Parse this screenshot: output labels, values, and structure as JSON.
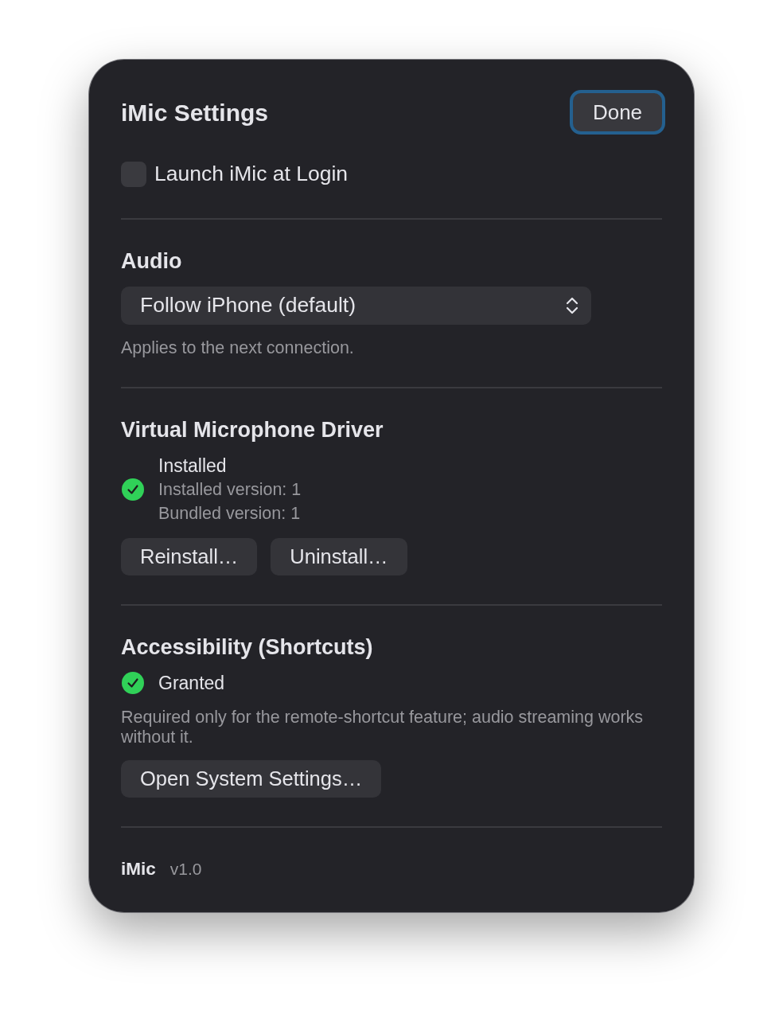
{
  "window": {
    "title": "iMic Settings",
    "done_button": {
      "label": "Done",
      "focused": true
    }
  },
  "launch_at_login": {
    "label": "Launch iMic at Login",
    "checked": false
  },
  "sections": [
    {
      "heading": "Audio",
      "select": {
        "value": "Follow iPhone (default)"
      },
      "hint": "Applies to the next connection."
    },
    {
      "heading": "Virtual Microphone Driver",
      "status": {
        "label": "Installed",
        "ok": true,
        "details": [
          "Installed version: 1",
          "Bundled version: 1"
        ]
      },
      "buttons": [
        "Reinstall…",
        "Uninstall…"
      ]
    },
    {
      "heading": "Accessibility (Shortcuts)",
      "status": {
        "label": "Granted",
        "ok": true
      },
      "description": "Required only for the remote-shortcut feature; audio streaming works without it.",
      "buttons": [
        "Open System Settings…"
      ]
    }
  ],
  "footer": {
    "app_name": "iMic",
    "version": "v1.0"
  }
}
